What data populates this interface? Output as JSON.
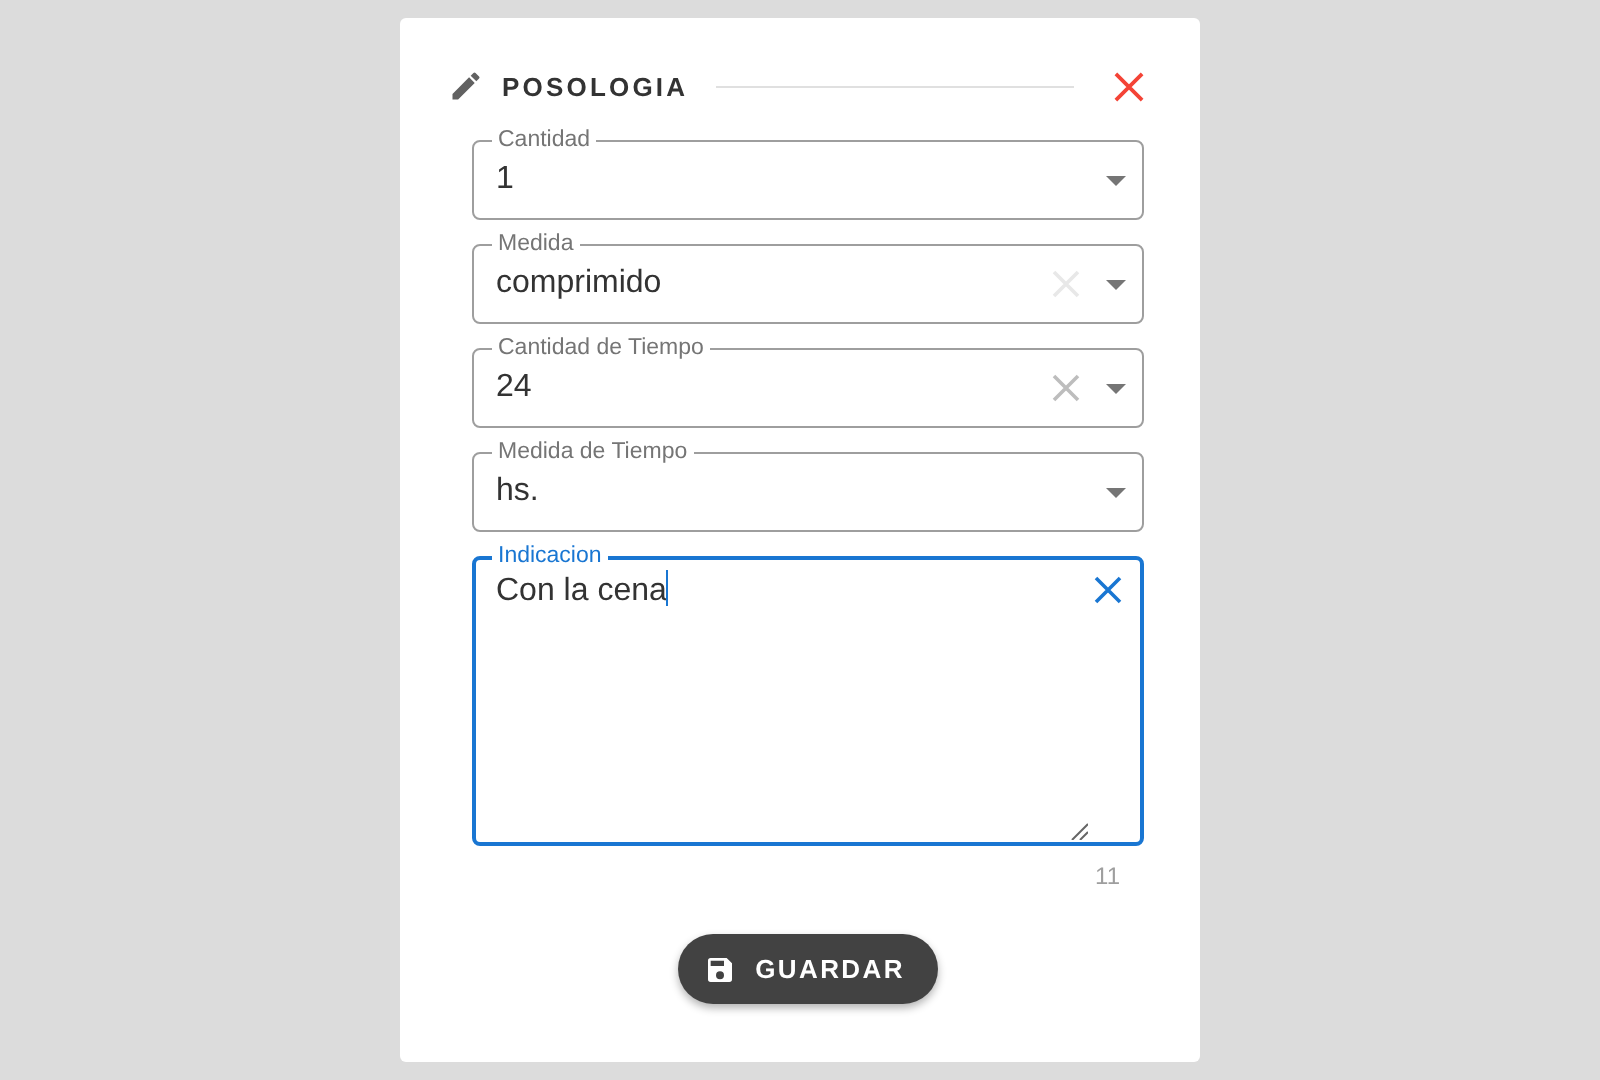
{
  "dialog": {
    "title": "POSOLOGIA",
    "fields": [
      {
        "kind": "select",
        "label": "Cantidad",
        "value": "1",
        "clearable": false
      },
      {
        "kind": "select",
        "label": "Medida",
        "value": "comprimido",
        "clearable": true,
        "clear_faded": true
      },
      {
        "kind": "select",
        "label": "Cantidad de Tiempo",
        "value": "24",
        "clearable": true,
        "clear_faded": false
      },
      {
        "kind": "select",
        "label": "Medida de Tiempo",
        "value": "hs.",
        "clearable": false
      },
      {
        "kind": "textarea",
        "label": "Indicacion",
        "value": "Con la cena",
        "focused": true,
        "clearable": true,
        "counter": "11"
      }
    ],
    "button": "GUARDAR"
  }
}
